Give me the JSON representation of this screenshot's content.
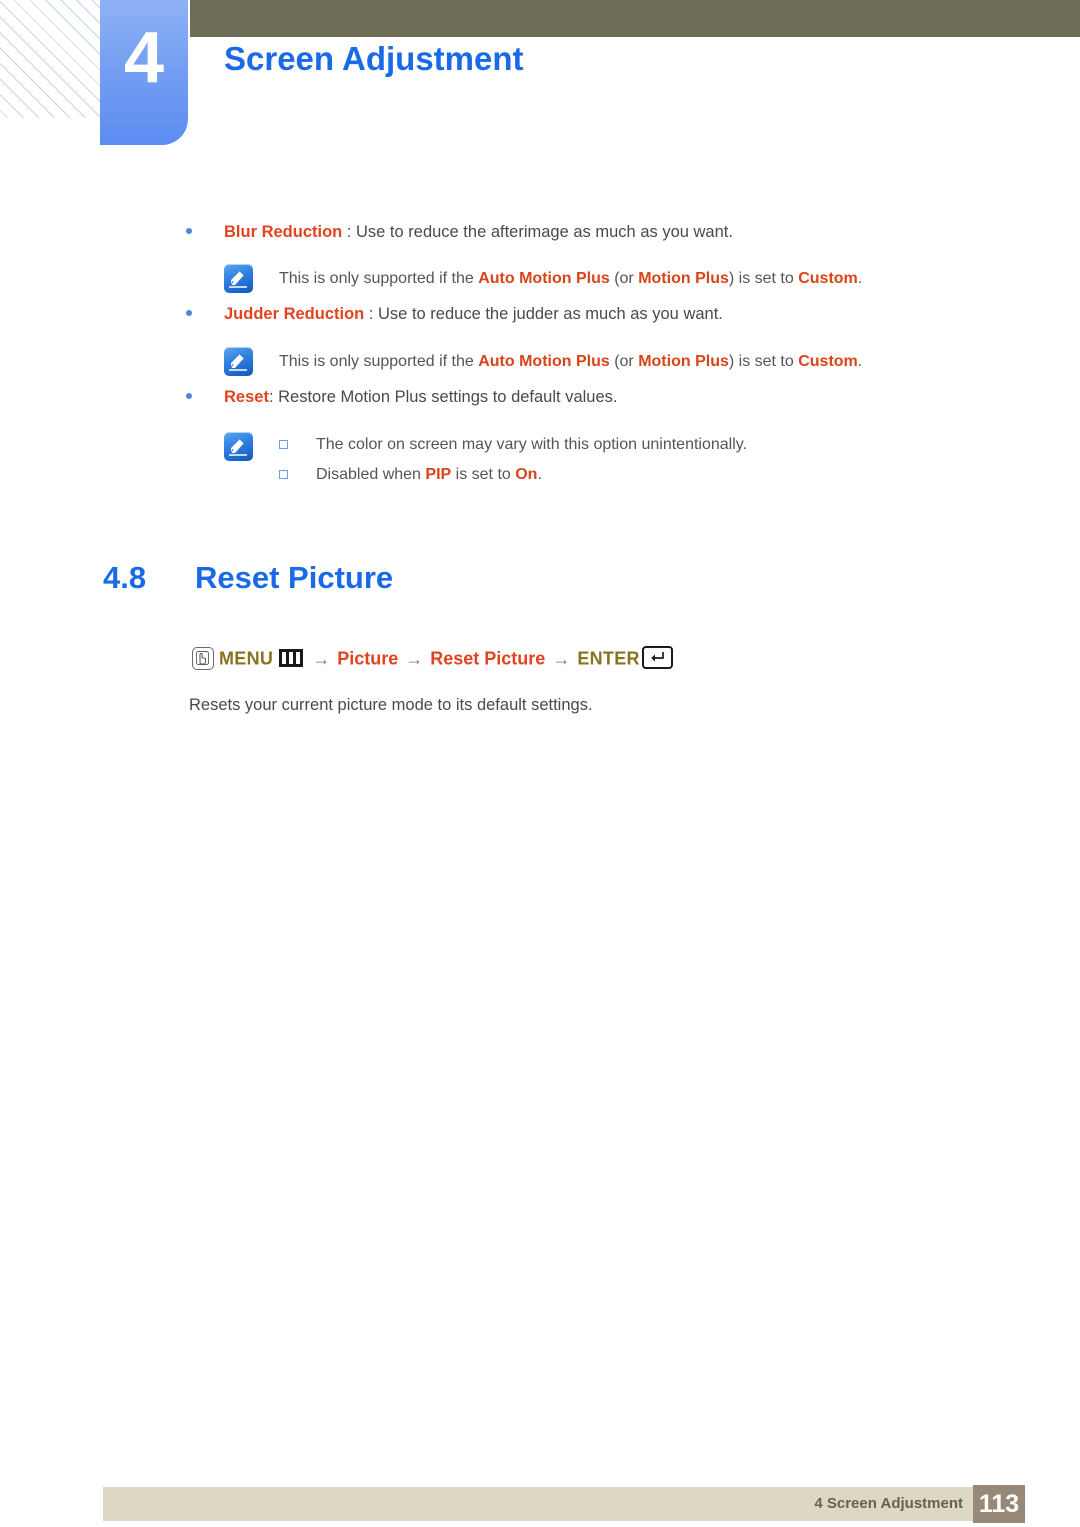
{
  "header": {
    "chapter_number": "4",
    "chapter_title": "Screen Adjustment",
    "tab_color": "#6f9cf2",
    "bar_color": "#6e6b56"
  },
  "bullets": [
    {
      "keyword": "Blur Reduction",
      "rest": " : Use to reduce the afterimage as much as you want."
    },
    {
      "keyword": "Judder Reduction",
      "rest": " : Use to reduce the judder as much as you want."
    },
    {
      "keyword": "Reset",
      "rest": ": Restore Motion Plus settings to default values."
    }
  ],
  "notes": {
    "note1": {
      "icon": "note-pencil-icon",
      "pre": "This is only supported if the ",
      "kw1": "Auto Motion Plus",
      "mid1": " (or ",
      "kw2": "Motion Plus",
      "mid2": ") is set to ",
      "kw3": "Custom",
      "end": "."
    },
    "note2": {
      "icon": "note-pencil-icon",
      "pre": "This is only supported if the ",
      "kw1": "Auto Motion Plus",
      "mid1": " (or ",
      "kw2": "Motion Plus",
      "mid2": ") is set to ",
      "kw3": "Custom",
      "end": "."
    },
    "note3": {
      "icon": "note-pencil-icon",
      "line1": "The color on screen may vary with this option unintentionally.",
      "line2_pre": "Disabled when ",
      "line2_kw1": "PIP",
      "line2_mid": " is set to ",
      "line2_kw2": "On",
      "line2_end": "."
    }
  },
  "section": {
    "number": "4.8",
    "title": "Reset Picture"
  },
  "menu_path": {
    "press_icon": "hand-press-icon",
    "menu_label": "MENU",
    "menu_glyph": "menu-bars-icon",
    "arrow": "→",
    "step1": "Picture",
    "step2": "Reset Picture",
    "enter_label": "ENTER",
    "enter_glyph": "enter-key-icon"
  },
  "description": "Resets your current picture mode to its default settings.",
  "footer": {
    "label": "4 Screen Adjustment",
    "page_number": "113",
    "bar_color": "#ddd8c3",
    "page_box_color": "#988879"
  },
  "colors": {
    "heading_blue": "#1a6ae8",
    "highlight_orange": "#e3431f",
    "menu_olive": "#8a7320",
    "body_gray": "#4a4a4a"
  }
}
